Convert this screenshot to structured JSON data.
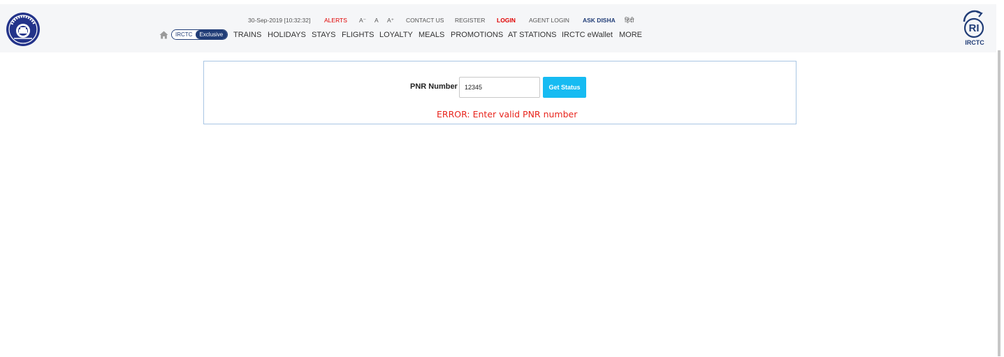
{
  "header": {
    "datetime": "30-Sep-2019 [10:32:32]",
    "util_links": {
      "alerts": "ALERTS",
      "font_decrease": "A⁻",
      "font_normal": "A",
      "font_increase": "A⁺",
      "contact_us": "CONTACT US",
      "register": "REGISTER",
      "login": "LOGIN",
      "agent_login": "AGENT LOGIN",
      "ask_disha": "ASK DISHA",
      "hindi": "हिंदी"
    },
    "exclusive_badge": {
      "brand": "IRCTC",
      "label": "Exclusive"
    },
    "nav": {
      "trains": "TRAINS",
      "holidays": "HOLIDAYS",
      "stays": "STAYS",
      "flights": "FLIGHTS",
      "loyalty": "LOYALTY",
      "meals": "MEALS",
      "promotions": "PROMOTIONS",
      "at_stations": "AT STATIONS",
      "ewallet": "IRCTC eWallet",
      "more": "MORE"
    },
    "logo_text": "IRCTC"
  },
  "pnr": {
    "label": "PNR Number",
    "input_value": "12345",
    "button_label": "Get Status",
    "error": "ERROR: Enter valid PNR number"
  },
  "icons": {
    "home": "home-icon",
    "railway": "indian-railways-logo",
    "irctc": "irctc-logo"
  },
  "colors": {
    "navy": "#213d77",
    "alert_red": "#e00000",
    "button_blue": "#16bbf2",
    "error_red": "#e8241c",
    "panel_border": "#a9c6e4",
    "header_bg": "#f5f6f8"
  }
}
